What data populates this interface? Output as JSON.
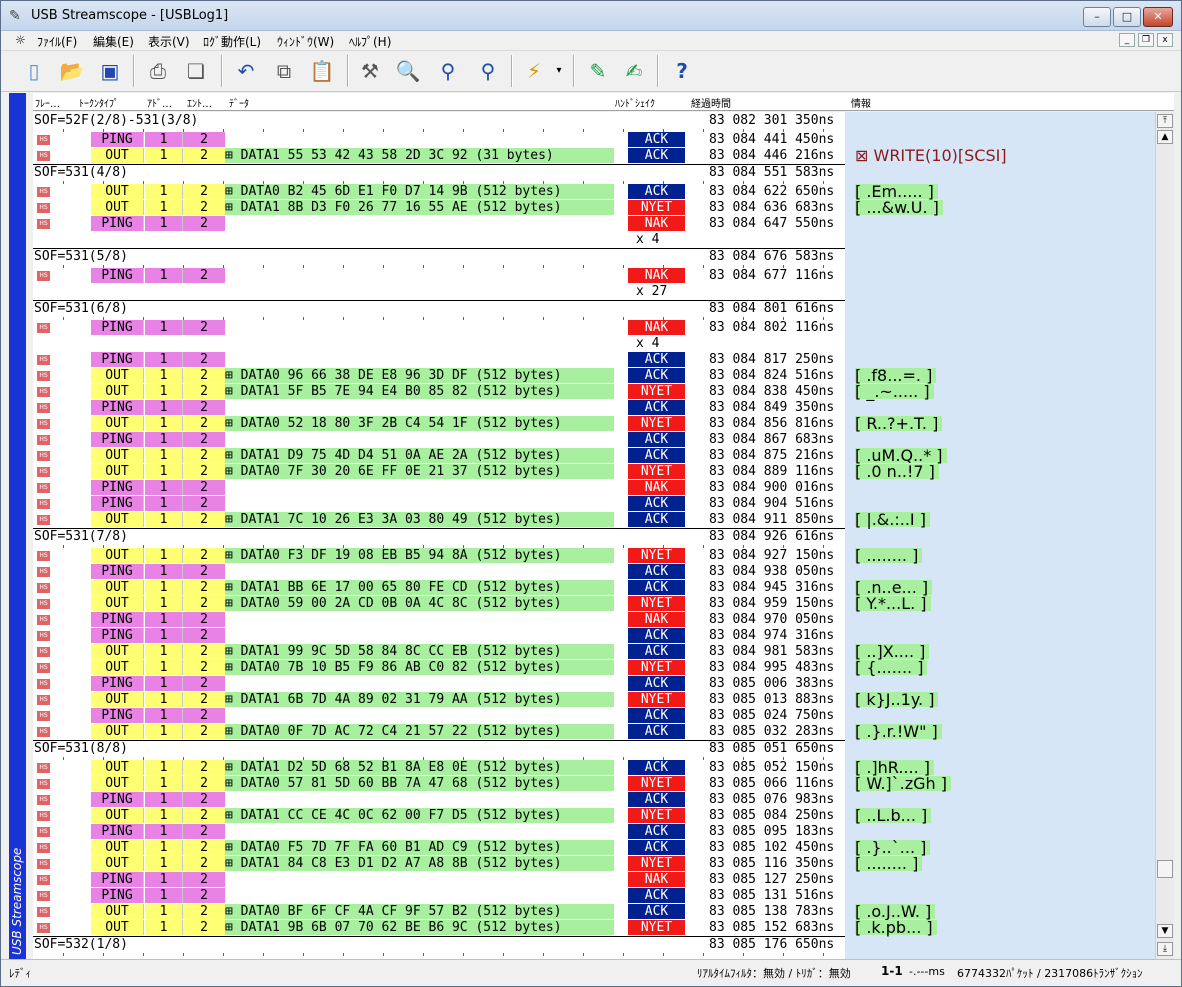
{
  "window": {
    "title": "USB Streamscope - [USBLog1]",
    "min": "–",
    "max": "□",
    "close": "✕"
  },
  "menu": [
    "ﾌｧｲﾙ(F)",
    "編集(E)",
    "表示(V)",
    "ﾛｸﾞ動作(L)",
    "ｳｨﾝﾄﾞｳ(W)",
    "ﾍﾙﾌﾟ(H)"
  ],
  "mdi": {
    "min": "_",
    "restore": "❐",
    "close": "x"
  },
  "toolbar": {
    "help": "?"
  },
  "banner": "USB Streamscope",
  "columns": [
    "ﾌﾚｰ…",
    "ﾄｰｸﾝﾀｲﾌﾟ",
    "ｱﾄﾞ…",
    "ｴﾝﾄ…",
    "ﾃﾞｰﾀ",
    "ﾊﾝﾄﾞｼｪｲｸ",
    "経過時間",
    "情報"
  ],
  "status": {
    "ready": "ﾚﾃﾞｨ",
    "filter": "ﾘｱﾙﾀｲﾑﾌｨﾙﾀ：無効 / ﾄﾘｶﾞ：無効",
    "range": "1-1",
    "unit": "-.---ms",
    "counts": "6774332ﾊﾟｹｯﾄ / 2317086ﾄﾗﾝｻﾞｸｼｮﾝ"
  },
  "colors": {
    "ping": "#e982e5",
    "out": "#ffff74",
    "data": "#a8f0a0",
    "ack": "#002190",
    "nak": "#f21919",
    "banner": "#1a33d6"
  },
  "rows": [
    {
      "k": "sof",
      "t": "SOF=52F(2/8)-531(3/8)",
      "time": "83 082 301 350ns"
    },
    {
      "k": "pkt",
      "tok": "PING",
      "ad": "1",
      "en": "2",
      "data": "",
      "hsk": "ACK",
      "time": "83 084 441 450ns",
      "info": ""
    },
    {
      "k": "pkt",
      "tok": "OUT",
      "ad": "1",
      "en": "2",
      "data": "DATA1 55 53 42 43 58 2D 3C 92 (31 bytes)",
      "hsk": "ACK",
      "time": "83 084 446 216ns",
      "info": "WRITE(10)[SCSI]"
    },
    {
      "k": "sof",
      "t": "SOF=531(4/8)",
      "time": "83 084 551 583ns"
    },
    {
      "k": "pkt",
      "tok": "OUT",
      "ad": "1",
      "en": "2",
      "data": "DATA0 B2 45 6D E1 F0 D7 14 9B (512 bytes)",
      "hsk": "ACK",
      "time": "83 084 622 650ns",
      "info": "[ .Em..... ]"
    },
    {
      "k": "pkt",
      "tok": "OUT",
      "ad": "1",
      "en": "2",
      "data": "DATA1 8B D3 F0 26 77 16 55 AE (512 bytes)",
      "hsk": "NYET",
      "time": "83 084 636 683ns",
      "info": "[ ...&w.U. ]"
    },
    {
      "k": "pkt",
      "tok": "PING",
      "ad": "1",
      "en": "2",
      "data": "",
      "hsk": "NAK",
      "time": "83 084 647 550ns",
      "info": ""
    },
    {
      "k": "cnt",
      "x": "x 4"
    },
    {
      "k": "sof",
      "t": "SOF=531(5/8)",
      "time": "83 084 676 583ns"
    },
    {
      "k": "pkt",
      "tok": "PING",
      "ad": "1",
      "en": "2",
      "data": "",
      "hsk": "NAK",
      "time": "83 084 677 116ns",
      "info": ""
    },
    {
      "k": "cnt",
      "x": "x 27"
    },
    {
      "k": "sof",
      "t": "SOF=531(6/8)",
      "time": "83 084 801 616ns"
    },
    {
      "k": "pkt",
      "tok": "PING",
      "ad": "1",
      "en": "2",
      "data": "",
      "hsk": "NAK",
      "time": "83 084 802 116ns",
      "info": ""
    },
    {
      "k": "cnt",
      "x": "x 4"
    },
    {
      "k": "pkt",
      "tok": "PING",
      "ad": "1",
      "en": "2",
      "data": "",
      "hsk": "ACK",
      "time": "83 084 817 250ns",
      "info": ""
    },
    {
      "k": "pkt",
      "tok": "OUT",
      "ad": "1",
      "en": "2",
      "data": "DATA0 96 66 38 DE E8 96 3D DF (512 bytes)",
      "hsk": "ACK",
      "time": "83 084 824 516ns",
      "info": "[ .f8...=. ]"
    },
    {
      "k": "pkt",
      "tok": "OUT",
      "ad": "1",
      "en": "2",
      "data": "DATA1 5F B5 7E 94 E4 B0 85 82 (512 bytes)",
      "hsk": "NYET",
      "time": "83 084 838 450ns",
      "info": "[ _.~..... ]"
    },
    {
      "k": "pkt",
      "tok": "PING",
      "ad": "1",
      "en": "2",
      "data": "",
      "hsk": "ACK",
      "time": "83 084 849 350ns",
      "info": ""
    },
    {
      "k": "pkt",
      "tok": "OUT",
      "ad": "1",
      "en": "2",
      "data": "DATA0 52 18 80 3F 2B C4 54 1F (512 bytes)",
      "hsk": "NYET",
      "time": "83 084 856 816ns",
      "info": "[ R..?+.T. ]"
    },
    {
      "k": "pkt",
      "tok": "PING",
      "ad": "1",
      "en": "2",
      "data": "",
      "hsk": "ACK",
      "time": "83 084 867 683ns",
      "info": ""
    },
    {
      "k": "pkt",
      "tok": "OUT",
      "ad": "1",
      "en": "2",
      "data": "DATA1 D9 75 4D D4 51 0A AE 2A (512 bytes)",
      "hsk": "ACK",
      "time": "83 084 875 216ns",
      "info": "[ .uM.Q..* ]"
    },
    {
      "k": "pkt",
      "tok": "OUT",
      "ad": "1",
      "en": "2",
      "data": "DATA0 7F 30 20 6E FF 0E 21 37 (512 bytes)",
      "hsk": "NYET",
      "time": "83 084 889 116ns",
      "info": "[ .0 n..!7 ]"
    },
    {
      "k": "pkt",
      "tok": "PING",
      "ad": "1",
      "en": "2",
      "data": "",
      "hsk": "NAK",
      "time": "83 084 900 016ns",
      "info": ""
    },
    {
      "k": "pkt",
      "tok": "PING",
      "ad": "1",
      "en": "2",
      "data": "",
      "hsk": "ACK",
      "time": "83 084 904 516ns",
      "info": ""
    },
    {
      "k": "pkt",
      "tok": "OUT",
      "ad": "1",
      "en": "2",
      "data": "DATA1 7C 10 26 E3 3A 03 80 49 (512 bytes)",
      "hsk": "ACK",
      "time": "83 084 911 850ns",
      "info": "[ |.&.:..I ]"
    },
    {
      "k": "sof",
      "t": "SOF=531(7/8)",
      "time": "83 084 926 616ns"
    },
    {
      "k": "pkt",
      "tok": "OUT",
      "ad": "1",
      "en": "2",
      "data": "DATA0 F3 DF 19 08 EB B5 94 8A (512 bytes)",
      "hsk": "NYET",
      "time": "83 084 927 150ns",
      "info": "[ ........ ]"
    },
    {
      "k": "pkt",
      "tok": "PING",
      "ad": "1",
      "en": "2",
      "data": "",
      "hsk": "ACK",
      "time": "83 084 938 050ns",
      "info": ""
    },
    {
      "k": "pkt",
      "tok": "OUT",
      "ad": "1",
      "en": "2",
      "data": "DATA1 BB 6E 17 00 65 80 FE CD (512 bytes)",
      "hsk": "ACK",
      "time": "83 084 945 316ns",
      "info": "[ .n..e... ]"
    },
    {
      "k": "pkt",
      "tok": "OUT",
      "ad": "1",
      "en": "2",
      "data": "DATA0 59 00 2A CD 0B 0A 4C 8C (512 bytes)",
      "hsk": "NYET",
      "time": "83 084 959 150ns",
      "info": "[ Y.*...L. ]"
    },
    {
      "k": "pkt",
      "tok": "PING",
      "ad": "1",
      "en": "2",
      "data": "",
      "hsk": "NAK",
      "time": "83 084 970 050ns",
      "info": ""
    },
    {
      "k": "pkt",
      "tok": "PING",
      "ad": "1",
      "en": "2",
      "data": "",
      "hsk": "ACK",
      "time": "83 084 974 316ns",
      "info": ""
    },
    {
      "k": "pkt",
      "tok": "OUT",
      "ad": "1",
      "en": "2",
      "data": "DATA1 99 9C 5D 58 84 8C CC EB (512 bytes)",
      "hsk": "ACK",
      "time": "83 084 981 583ns",
      "info": "[ ..]X.... ]"
    },
    {
      "k": "pkt",
      "tok": "OUT",
      "ad": "1",
      "en": "2",
      "data": "DATA0 7B 10 B5 F9 86 AB C0 82 (512 bytes)",
      "hsk": "NYET",
      "time": "83 084 995 483ns",
      "info": "[ {....... ]"
    },
    {
      "k": "pkt",
      "tok": "PING",
      "ad": "1",
      "en": "2",
      "data": "",
      "hsk": "ACK",
      "time": "83 085 006 383ns",
      "info": ""
    },
    {
      "k": "pkt",
      "tok": "OUT",
      "ad": "1",
      "en": "2",
      "data": "DATA1 6B 7D 4A 89 02 31 79 AA (512 bytes)",
      "hsk": "NYET",
      "time": "83 085 013 883ns",
      "info": "[ k}J..1y. ]"
    },
    {
      "k": "pkt",
      "tok": "PING",
      "ad": "1",
      "en": "2",
      "data": "",
      "hsk": "ACK",
      "time": "83 085 024 750ns",
      "info": ""
    },
    {
      "k": "pkt",
      "tok": "OUT",
      "ad": "1",
      "en": "2",
      "data": "DATA0 0F 7D AC 72 C4 21 57 22 (512 bytes)",
      "hsk": "ACK",
      "time": "83 085 032 283ns",
      "info": "[ .}.r.!W\" ]"
    },
    {
      "k": "sof",
      "t": "SOF=531(8/8)",
      "time": "83 085 051 650ns"
    },
    {
      "k": "pkt",
      "tok": "OUT",
      "ad": "1",
      "en": "2",
      "data": "DATA1 D2 5D 68 52 B1 8A E8 0E (512 bytes)",
      "hsk": "ACK",
      "time": "83 085 052 150ns",
      "info": "[ .]hR.... ]"
    },
    {
      "k": "pkt",
      "tok": "OUT",
      "ad": "1",
      "en": "2",
      "data": "DATA0 57 81 5D 60 BB 7A 47 68 (512 bytes)",
      "hsk": "NYET",
      "time": "83 085 066 116ns",
      "info": "[ W.]`.zGh ]"
    },
    {
      "k": "pkt",
      "tok": "PING",
      "ad": "1",
      "en": "2",
      "data": "",
      "hsk": "ACK",
      "time": "83 085 076 983ns",
      "info": ""
    },
    {
      "k": "pkt",
      "tok": "OUT",
      "ad": "1",
      "en": "2",
      "data": "DATA1 CC CE 4C 0C 62 00 F7 D5 (512 bytes)",
      "hsk": "NYET",
      "time": "83 085 084 250ns",
      "info": "[ ..L.b... ]"
    },
    {
      "k": "pkt",
      "tok": "PING",
      "ad": "1",
      "en": "2",
      "data": "",
      "hsk": "ACK",
      "time": "83 085 095 183ns",
      "info": ""
    },
    {
      "k": "pkt",
      "tok": "OUT",
      "ad": "1",
      "en": "2",
      "data": "DATA0 F5 7D 7F FA 60 B1 AD C9 (512 bytes)",
      "hsk": "ACK",
      "time": "83 085 102 450ns",
      "info": "[ .}..`... ]"
    },
    {
      "k": "pkt",
      "tok": "OUT",
      "ad": "1",
      "en": "2",
      "data": "DATA1 84 C8 E3 D1 D2 A7 A8 8B (512 bytes)",
      "hsk": "NYET",
      "time": "83 085 116 350ns",
      "info": "[ ........ ]"
    },
    {
      "k": "pkt",
      "tok": "PING",
      "ad": "1",
      "en": "2",
      "data": "",
      "hsk": "NAK",
      "time": "83 085 127 250ns",
      "info": ""
    },
    {
      "k": "pkt",
      "tok": "PING",
      "ad": "1",
      "en": "2",
      "data": "",
      "hsk": "ACK",
      "time": "83 085 131 516ns",
      "info": ""
    },
    {
      "k": "pkt",
      "tok": "OUT",
      "ad": "1",
      "en": "2",
      "data": "DATA0 BF 6F CF 4A CF 9F 57 B2 (512 bytes)",
      "hsk": "ACK",
      "time": "83 085 138 783ns",
      "info": "[ .o.J..W. ]"
    },
    {
      "k": "pkt",
      "tok": "OUT",
      "ad": "1",
      "en": "2",
      "data": "DATA1 9B 6B 07 70 62 BE B6 9C (512 bytes)",
      "hsk": "NYET",
      "time": "83 085 152 683ns",
      "info": "[ .k.pb... ]"
    },
    {
      "k": "sof",
      "t": "SOF=532(1/8)",
      "time": "83 085 176 650ns"
    }
  ]
}
